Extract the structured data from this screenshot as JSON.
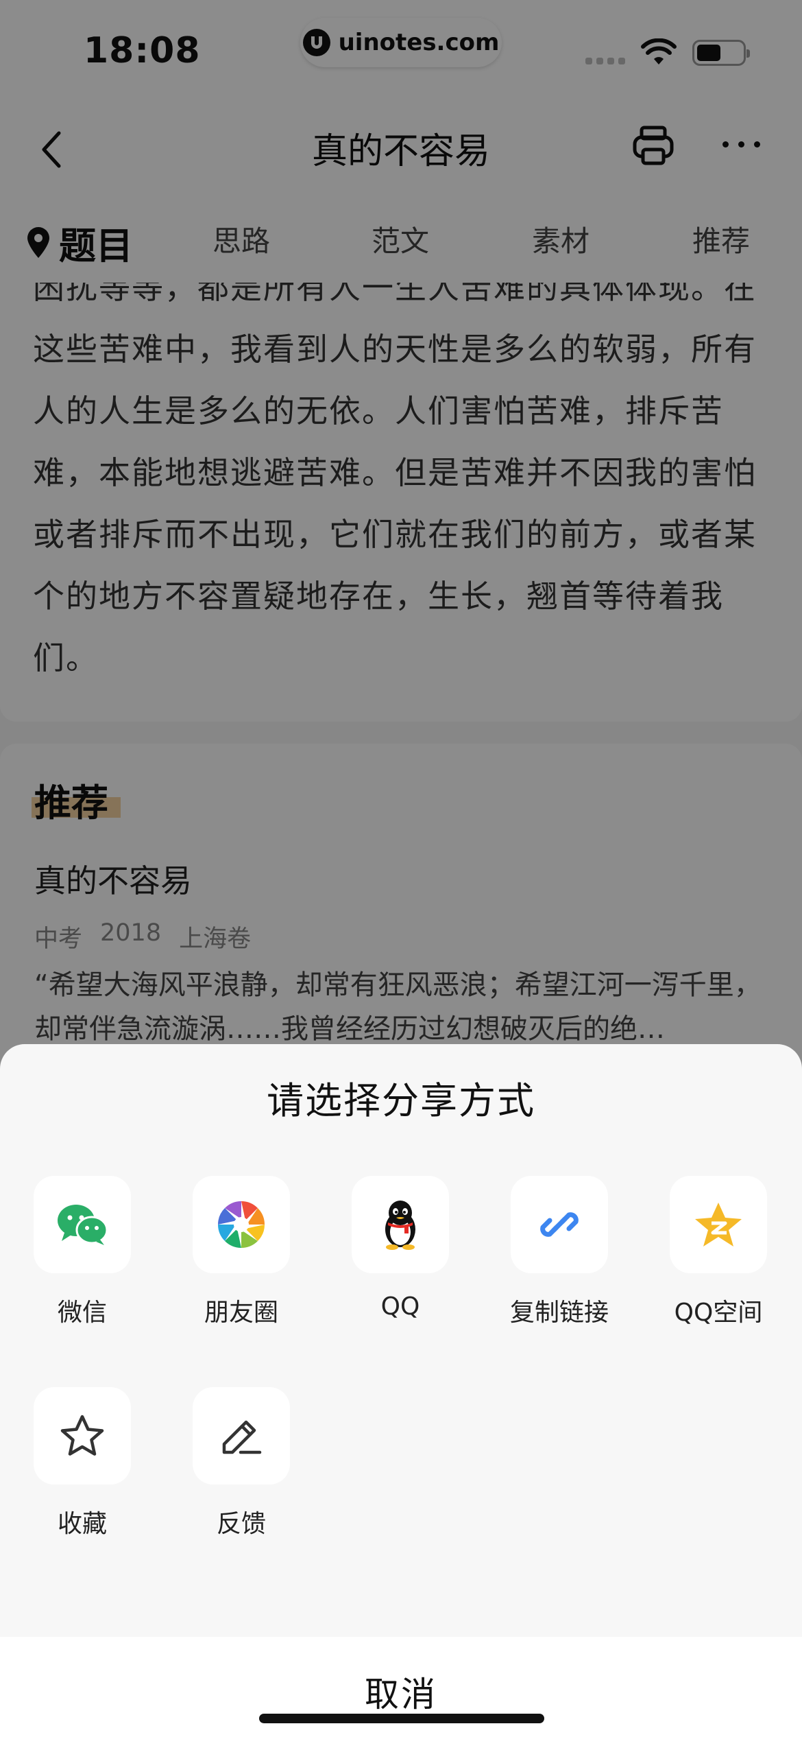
{
  "status_bar": {
    "time": "18:08",
    "watermark": "uinotes.com"
  },
  "nav": {
    "title": "真的不容易"
  },
  "tabs": [
    {
      "label": "题目",
      "active": true
    },
    {
      "label": "思路",
      "active": false
    },
    {
      "label": "范文",
      "active": false
    },
    {
      "label": "素材",
      "active": false
    },
    {
      "label": "推荐",
      "active": false
    }
  ],
  "article": {
    "lines": [
      "困扰等等，都是所有人一生人苦难的具体体现。在",
      "这些苦难中，我看到人的天性是多么的软弱，所有",
      "人的人生是多么的无依。人们害怕苦难，排斥苦",
      "难，本能地想逃避苦难。但是苦难并不因我的害怕",
      "或者排斥而不出现，它们就在我们的前方，或者某",
      "个的地方不容置疑地存在，生长，翘首等待着我",
      "们。"
    ]
  },
  "recommend": {
    "heading": "推荐",
    "title": "真的不容易",
    "meta": [
      "中考",
      "2018",
      "上海卷"
    ],
    "excerpt": "“希望大海风平浪静，却常有狂风恶浪；希望江河一泻千里，却常伴急流漩涡……我曾经经历过幻想破灭后的绝…"
  },
  "share_sheet": {
    "title": "请选择分享方式",
    "items": [
      {
        "label": "微信",
        "icon": "wechat-icon"
      },
      {
        "label": "朋友圈",
        "icon": "moments-icon"
      },
      {
        "label": "QQ",
        "icon": "qq-icon"
      },
      {
        "label": "复制链接",
        "icon": "link-icon"
      },
      {
        "label": "QQ空间",
        "icon": "qzone-icon"
      },
      {
        "label": "收藏",
        "icon": "star-icon"
      },
      {
        "label": "反馈",
        "icon": "edit-icon"
      }
    ],
    "cancel": "取消"
  },
  "colors": {
    "wechat": "#2aae67",
    "link": "#3d86f0",
    "qzone": "#f5b928",
    "highlight": "#f3c58a"
  }
}
